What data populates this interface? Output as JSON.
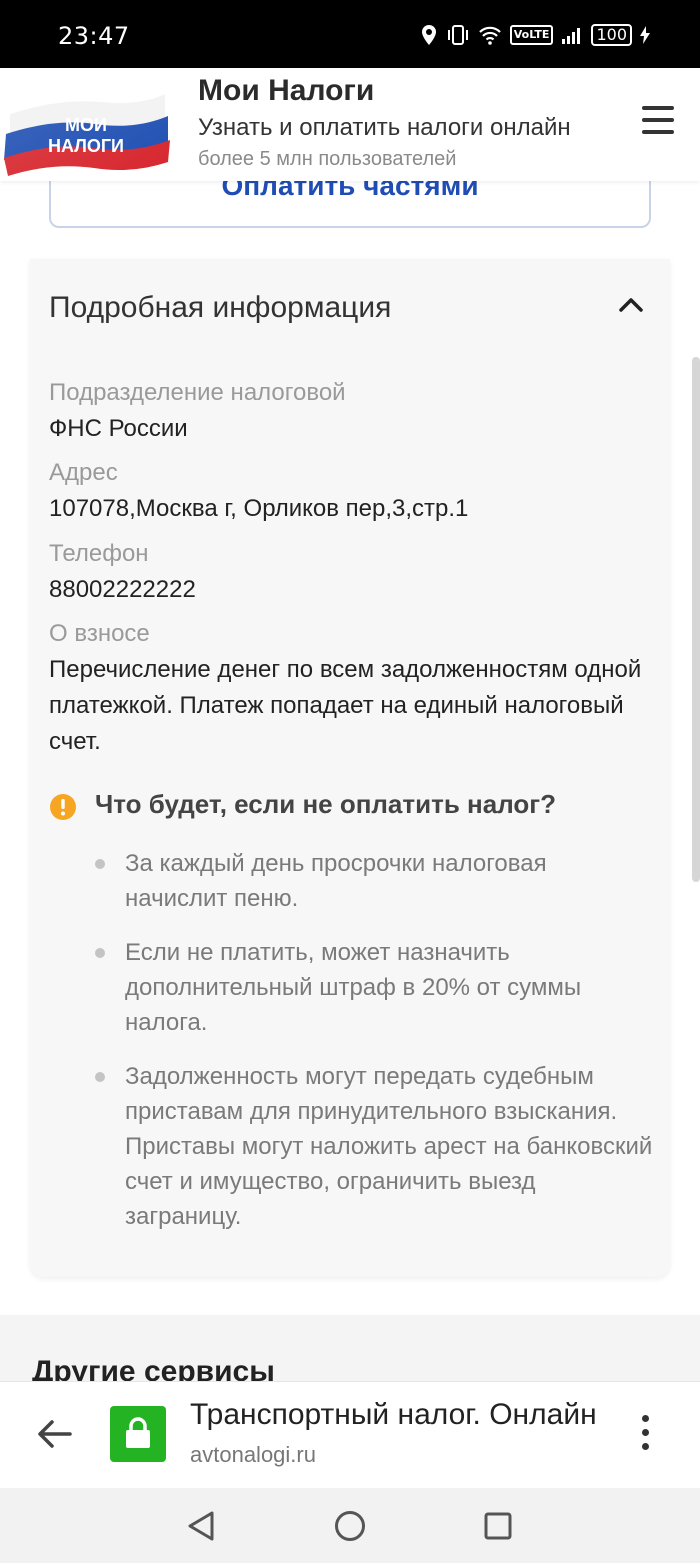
{
  "status_bar": {
    "time": "23:47",
    "volte": "VoLTE",
    "battery": "100"
  },
  "header": {
    "logo_line1": "МОИ",
    "logo_line2": "НАЛОГИ",
    "title": "Мои Налоги",
    "subtitle": "Узнать и оплатить налоги онлайн",
    "users": "более 5 млн пользователей"
  },
  "pay_parts": {
    "label": "Оплатить частями"
  },
  "details": {
    "heading": "Подробная информация",
    "fields": [
      {
        "label": "Подразделение налоговой",
        "value": "ФНС России"
      },
      {
        "label": "Адрес",
        "value": "107078,Москва г, Орликов пер,3,стр.1"
      },
      {
        "label": "Телефон",
        "value": "88002222222"
      },
      {
        "label": "О взносе",
        "value": "Перечисление денег по всем задолженностям одной платежкой. Платеж попадает на единый налоговый счет."
      }
    ],
    "warning": {
      "title": "Что будет, если не оплатить налог?",
      "items": [
        "За каждый день просрочки налоговая начислит пеню.",
        "Если не платить, может назначить дополнительный штраф в 20% от суммы налога.",
        "Задолженность могут передать судебным приставам для принудительного взыскания. Приставы могут наложить арест на банковский счет и имущество, ограничить выезд заграницу."
      ]
    }
  },
  "other_services": {
    "title": "Другие сервисы"
  },
  "browser": {
    "page_title": "Транспортный налог. Онлайн",
    "domain": "avtonalogi.ru"
  },
  "colors": {
    "accent_blue": "#1f4db5",
    "warning_orange": "#f6a623",
    "lock_green": "#23b323",
    "card_bg": "#f7f7f7"
  }
}
